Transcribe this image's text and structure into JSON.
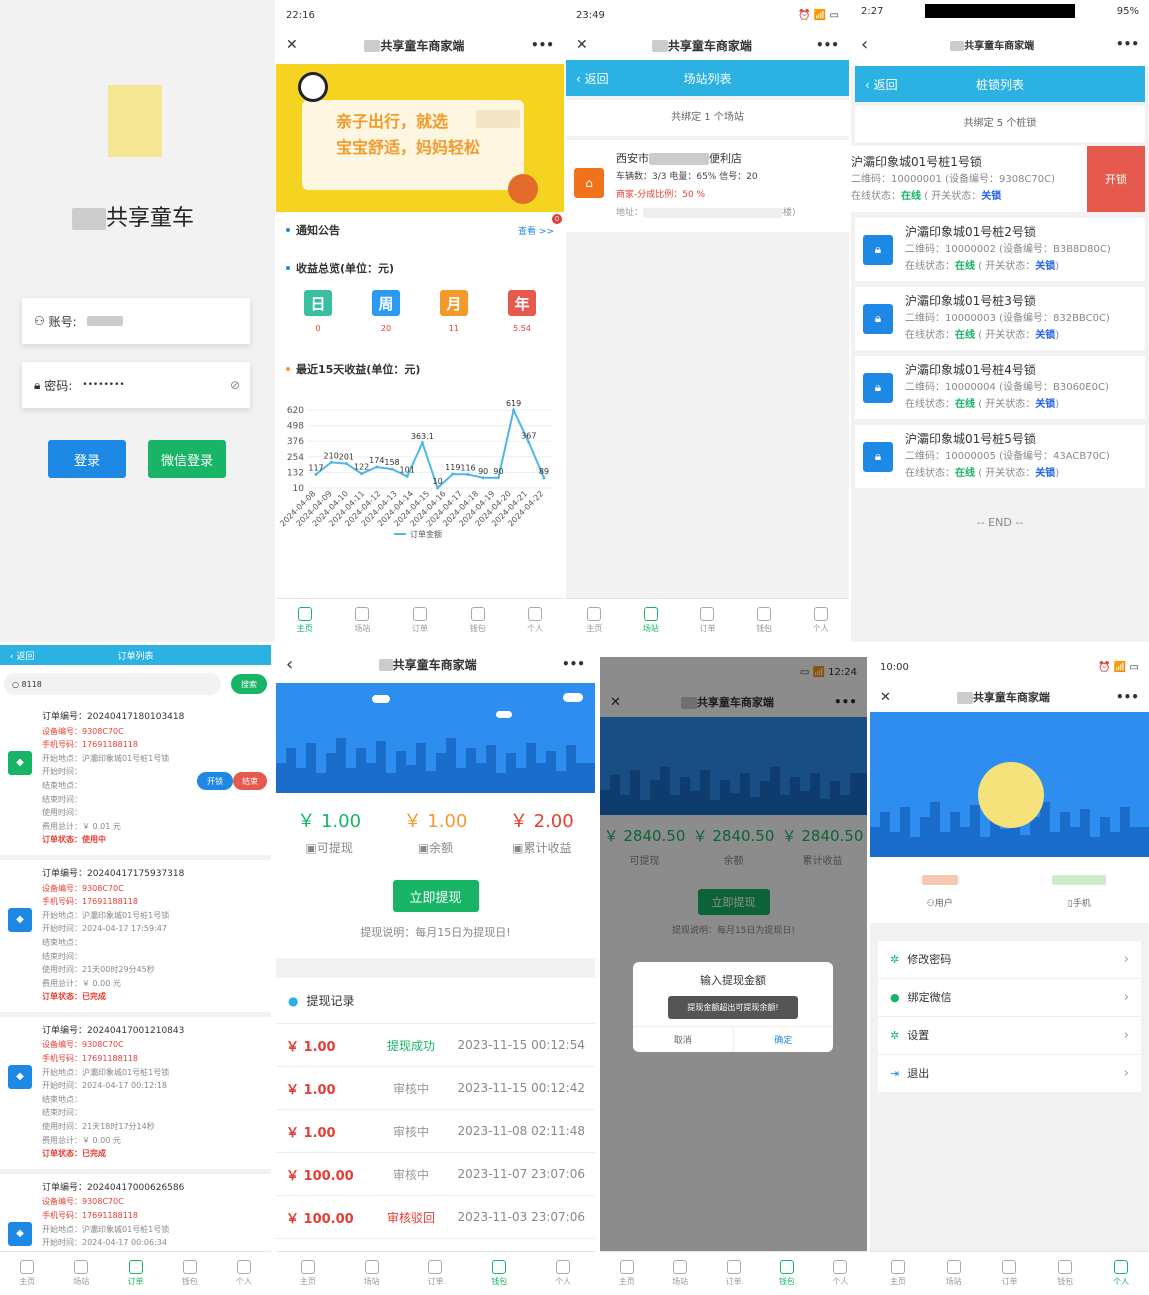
{
  "login": {
    "app_title": "共享童车",
    "account_label": "账号:",
    "password_label": "密码:",
    "password_value": "••••••••",
    "login_button": "登录",
    "wechat_button": "微信登录"
  },
  "home": {
    "time": "22:16",
    "nav_title": "共享童车商家端",
    "banner_line1": "亲子出行，就选",
    "banner_line2": "宝宝舒适，妈妈轻松",
    "notice_label": "通知公告",
    "notice_more": "查看 >>",
    "notice_badge": "0",
    "income_label": "收益总览(单位：元)",
    "periods": [
      {
        "label": "日",
        "value": "0",
        "color": "#3bbfa0"
      },
      {
        "label": "周",
        "value": "20",
        "color": "#2b9af3"
      },
      {
        "label": "月",
        "value": "11",
        "color": "#f39a2b"
      },
      {
        "label": "年",
        "value": "5.54",
        "color": "#e55a4d"
      }
    ],
    "chart_label": "最近15天收益(单位：元)"
  },
  "chart_data": {
    "type": "line",
    "title": "最近15天收益(单位：元)",
    "legend": "订单金额",
    "y_ticks": [
      620,
      498,
      376,
      254,
      132,
      10
    ],
    "ylim": [
      10,
      620
    ],
    "x": [
      "2024-04-08",
      "2024-04-09",
      "2024-04-10",
      "2024-04-11",
      "2024-04-12",
      "2024-04-13",
      "2024-04-14",
      "2024-04-15",
      "2024-04-16",
      "2024-04-17",
      "2024-04-18",
      "2024-04-19",
      "2024-04-20",
      "2024-04-21",
      "2024-04-22"
    ],
    "values": [
      117,
      210,
      201,
      122,
      174,
      158,
      101,
      363.1,
      10,
      119,
      116,
      90,
      90,
      619,
      367,
      89
    ],
    "data_labels": [
      "117",
      "210",
      "201",
      "122",
      "174",
      "158",
      "101",
      "363.1",
      "10",
      "119",
      "116",
      "90",
      "90",
      "619",
      "367",
      "89"
    ]
  },
  "stations": {
    "time": "23:49",
    "nav_title": "共享童车商家端",
    "back": "返回",
    "title": "场站列表",
    "count_text": "共绑定 1 个场站",
    "station_name": "西安市",
    "station_suffix": "便利店",
    "stats": "车辆数：3/3 电量：65% 信号：20",
    "share": "商家-分成比例：50 %",
    "address_label": "地址：",
    "address_suffix": "楼)"
  },
  "locks": {
    "time": "2:27",
    "battery": "95%",
    "nav_title": "共享童车商家端",
    "back": "返回",
    "title": "桩锁列表",
    "count_text": "共绑定 5 个桩锁",
    "open_button": "开锁",
    "online": "在线",
    "closed": "关锁",
    "items": [
      {
        "name": "沪灞印象城01号桩1号锁",
        "qr": "二维码：10000001 (设备编号：9308C70C)"
      },
      {
        "name": "沪灞印象城01号桩2号锁",
        "qr": "二维码：10000002 (设备编号：B3B8D80C)"
      },
      {
        "name": "沪灞印象城01号桩3号锁",
        "qr": "二维码：10000003 (设备编号：832BBC0C)"
      },
      {
        "name": "沪灞印象城01号桩4号锁",
        "qr": "二维码：10000004 (设备编号：B3060E0C)"
      },
      {
        "name": "沪灞印象城01号桩5号锁",
        "qr": "二维码：10000005 (设备编号：43ACB70C)"
      }
    ],
    "status_prefix": "在线状态：",
    "switch_prefix": "( 开关状态：",
    "end": "-- END --"
  },
  "orders": {
    "back": "返回",
    "title": "订单列表",
    "search_value": "8118",
    "search_button": "搜索",
    "open_button": "开锁",
    "end_button": "结束",
    "items": [
      {
        "no": "订单编号：20240417180103418",
        "dev": "设备编号：9308C70C",
        "phone": "手机号码：17691188118",
        "start_loc": "开始地点：沪灞印象城01号桩1号锁",
        "start_time": "开始时间：",
        "end_loc": "结束地点：",
        "end_time": "结束时间：",
        "use": "使用时间：",
        "fee": "费用总计：￥ 0.01 元",
        "status": "订单状态：使用中",
        "color": "#18b566"
      },
      {
        "no": "订单编号：20240417175937318",
        "dev": "设备编号：9308C70C",
        "phone": "手机号码：17691188118",
        "start_loc": "开始地点：沪灞印象城01号桩1号锁",
        "start_time": "开始时间：2024-04-17 17:59:47",
        "end_loc": "结束地点：",
        "end_time": "结束时间：",
        "use": "使用时间：21天00时29分45秒",
        "fee": "费用总计：￥ 0.00 元",
        "status": "订单状态：已完成",
        "color": "#1e88e5"
      },
      {
        "no": "订单编号：20240417001210843",
        "dev": "设备编号：9308C70C",
        "phone": "手机号码：17691188118",
        "start_loc": "开始地点：沪灞印象城01号桩1号锁",
        "start_time": "开始时间：2024-04-17 00:12:18",
        "end_loc": "结束地点：",
        "end_time": "结束时间：",
        "use": "使用时间：21天18时17分14秒",
        "fee": "费用总计：￥ 0.00 元",
        "status": "订单状态：已完成",
        "color": "#1e88e5"
      },
      {
        "no": "订单编号：20240417000626586",
        "dev": "设备编号：9308C70C",
        "phone": "手机号码：17691188118",
        "start_loc": "开始地点：沪灞印象城01号桩1号锁",
        "start_time": "开始时间：2024-04-17 00:06:34",
        "end_loc": "结束地点：",
        "end_time": "结束时间：",
        "use": "使用时间：21天18时32分58秒",
        "fee": "",
        "status": "",
        "color": "#1e88e5"
      }
    ]
  },
  "wallet": {
    "nav_title": "共享童车商家端",
    "withdrawable": "￥ 1.00",
    "balance": "￥ 1.00",
    "total": "￥ 2.00",
    "withdrawable_label": "可提现",
    "balance_label": "余额",
    "total_label": "累计收益",
    "withdraw_button": "立即提现",
    "note": "提现说明：每月15日为提现日!",
    "records_label": "提现记录",
    "records": [
      {
        "amount": "￥ 1.00",
        "status": "提现成功",
        "time": "2023-11-15 00:12:54",
        "color": "#18b566"
      },
      {
        "amount": "￥ 1.00",
        "status": "审核中",
        "time": "2023-11-15 00:12:42",
        "color": "#999"
      },
      {
        "amount": "￥ 1.00",
        "status": "审核中",
        "time": "2023-11-08 02:11:48",
        "color": "#999"
      },
      {
        "amount": "￥ 100.00",
        "status": "审核中",
        "time": "2023-11-07 23:07:06",
        "color": "#999"
      },
      {
        "amount": "￥ 100.00",
        "status": "审核驳回",
        "time": "2023-11-03 23:07:06",
        "color": "#e43d33"
      }
    ]
  },
  "wallet_dialog": {
    "time": "12:24",
    "nav_title": "共享童车商家端",
    "withdrawable": "￥ 2840.50",
    "balance": "￥ 2840.50",
    "total": "￥ 2840.50",
    "withdrawable_label": "可提现",
    "balance_label": "余额",
    "total_label": "累计收益",
    "withdraw_button": "立即提现",
    "note": "提现说明：每月15日为提现日!",
    "dialog_title": "输入提现金额",
    "dialog_toast": "提现金额超出可提现余额!",
    "cancel": "取消",
    "confirm": "确定"
  },
  "profile": {
    "time": "10:00",
    "nav_title": "共享童车商家端",
    "user_label": "用户",
    "phone_label": "手机",
    "menu": [
      "修改密码",
      "绑定微信",
      "设置",
      "退出"
    ]
  },
  "tabs": [
    "主页",
    "场站",
    "订单",
    "钱包",
    "个人"
  ]
}
